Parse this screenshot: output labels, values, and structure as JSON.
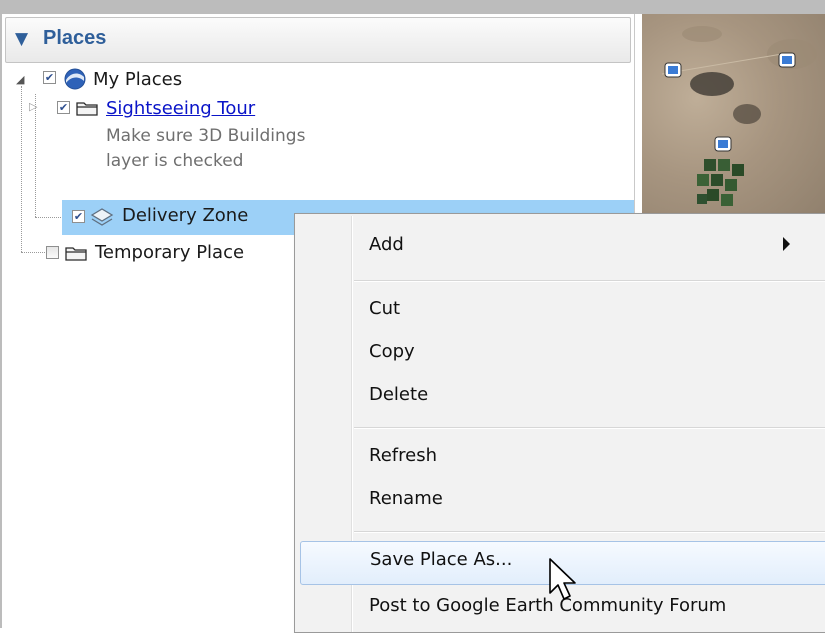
{
  "places_panel": {
    "title": "Places",
    "tree": [
      {
        "label": "My Places",
        "checked": true,
        "icon": "google-earth-globe-icon",
        "expanded": true
      },
      {
        "label": "Sightseeing Tour",
        "checked": true,
        "icon": "folder-icon",
        "link": true,
        "description": [
          "Make sure 3D Buildings",
          "layer is checked"
        ]
      },
      {
        "label": "Delivery Zone",
        "checked": true,
        "icon": "polygon-icon",
        "selected": true
      },
      {
        "label": "Temporary Place",
        "checked": false,
        "icon": "folder-icon"
      }
    ]
  },
  "context_menu": {
    "items": [
      {
        "label": "Add",
        "has_submenu": true
      },
      {
        "label": "Cut"
      },
      {
        "label": "Copy"
      },
      {
        "label": "Delete"
      },
      {
        "label": "Refresh"
      },
      {
        "label": "Rename"
      },
      {
        "label": "Save Place As...",
        "hovered": true
      },
      {
        "label": "Post to Google Earth Community Forum"
      }
    ]
  },
  "colors": {
    "header_text": "#2f5f9a",
    "selection": "#9cd0f7",
    "link": "#0a14c8",
    "menu_background": "#f2f2f2",
    "menu_hover": "#e2eefc"
  }
}
